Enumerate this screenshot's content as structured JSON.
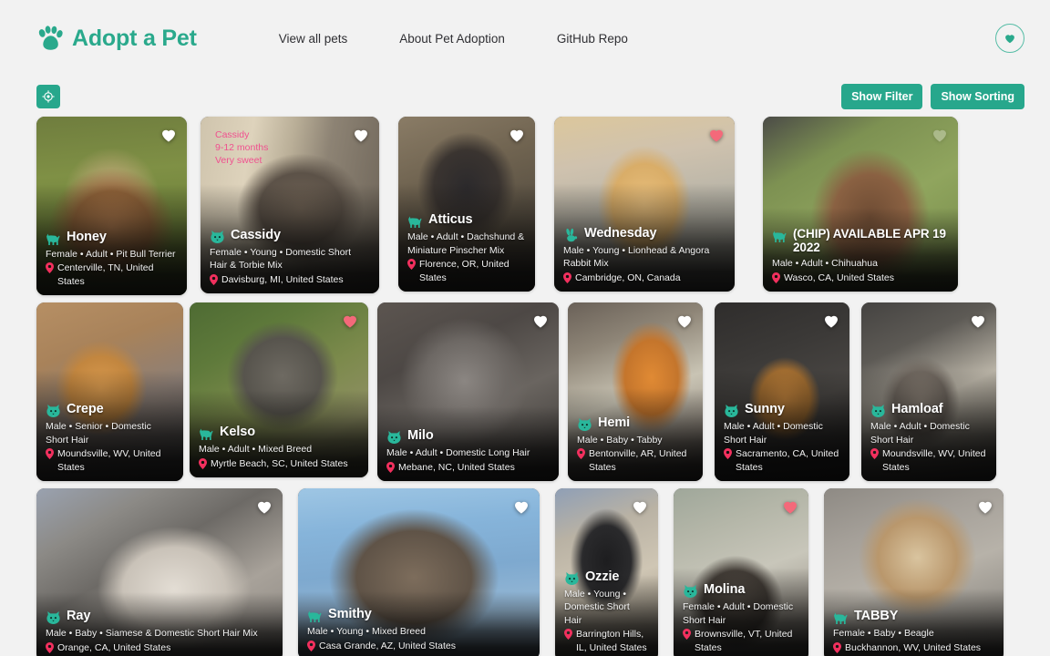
{
  "header": {
    "brand": "Adopt a Pet",
    "brand_color": "#2aa98c",
    "nav": [
      {
        "label": "View all pets"
      },
      {
        "label": "About Pet Adoption"
      },
      {
        "label": "GitHub Repo"
      }
    ],
    "favorites_icon": "heart-icon"
  },
  "toolbar": {
    "geolocate_icon": "target-crosshair-icon",
    "show_filter_label": "Show Filter",
    "show_sorting_label": "Show Sorting",
    "button_color": "#27a78c"
  },
  "colors": {
    "accent": "#27a78c",
    "heart_active": "#f4697a",
    "heart_inactive": "#ffffff",
    "pin": "#f2305e",
    "page_background": "#f2f2f2"
  },
  "pets": [
    {
      "name": "Honey",
      "meta": "Female • Adult • Pit Bull Terrier",
      "location": "Centerville, TN, United States",
      "species": "dog",
      "favorited": false,
      "photo_alt": "tan and white pit bull terrier standing in green grass"
    },
    {
      "name": "Cassidy",
      "meta": "Female • Young • Domestic Short Hair & Torbie Mix",
      "location": "Davisburg, MI, United States",
      "species": "cat",
      "favorited": false,
      "photo_caption": "Cassidy\n9-12 months\nVery sweet",
      "photo_alt": "grey tabby cat indoors"
    },
    {
      "name": "Atticus",
      "meta": "Male • Adult • Dachshund & Miniature Pinscher Mix",
      "location": "Florence, OR, United States",
      "species": "dog",
      "favorited": false,
      "photo_alt": "black and tan dachshund pinscher mix with purple leash"
    },
    {
      "name": "Wednesday",
      "meta": "Male • Young • Lionhead & Angora Rabbit Mix",
      "location": "Cambridge, ON, Canada",
      "species": "rabbit",
      "favorited": true,
      "photo_alt": "fluffy cream lionhead rabbit on a woven blanket"
    },
    {
      "name": "(CHIP) AVAILABLE APR 19 2022",
      "meta": "Male • Adult • Chihuahua",
      "location": "Wasco, CA, United States",
      "species": "dog",
      "favorited": false,
      "photo_alt": "brown chihuahua on green lawn"
    },
    {
      "name": "Crepe",
      "meta": "Male • Senior • Domestic Short Hair",
      "location": "Moundsville, WV, United States",
      "species": "cat",
      "favorited": false,
      "photo_alt": "orange tabby cat sitting in a cardboard box"
    },
    {
      "name": "Kelso",
      "meta": "Male • Adult • Mixed Breed",
      "location": "Myrtle Beach, SC, United States",
      "species": "dog",
      "favorited": true,
      "photo_alt": "brindle dog with tongue out in tall grass"
    },
    {
      "name": "Milo",
      "meta": "Male • Adult • Domestic Long Hair",
      "location": "Mebane, NC, United States",
      "species": "cat",
      "favorited": false,
      "photo_alt": "long haired grey and white cat close up"
    },
    {
      "name": "Hemi",
      "meta": "Male • Baby • Tabby",
      "location": "Bentonville, AR, United States",
      "species": "cat",
      "favorited": false,
      "photo_alt": "orange tabby kitten on a cat tree"
    },
    {
      "name": "Sunny",
      "meta": "Male • Adult • Domestic Short Hair",
      "location": "Sacramento, CA, United States",
      "species": "cat",
      "favorited": false,
      "photo_alt": "orange cat resting in a dark kennel"
    },
    {
      "name": "Hamloaf",
      "meta": "Male • Adult • Domestic Short Hair",
      "location": "Moundsville, WV, United States",
      "species": "cat",
      "favorited": false,
      "photo_alt": "tabby and white cat lying on patterned bedding"
    },
    {
      "name": "Ray",
      "meta": "Male • Baby • Siamese & Domestic Short Hair Mix",
      "location": "Orange, CA, United States",
      "species": "cat",
      "favorited": false,
      "photo_alt": "cream siamese mix kitten with blue eyes"
    },
    {
      "name": "Smithy",
      "meta": "Male • Young • Mixed Breed",
      "location": "Casa Grande, AZ, United States",
      "species": "dog",
      "favorited": false,
      "photo_alt": "brindle mixed breed dog against blue sky"
    },
    {
      "name": "Ozzie",
      "meta": "Male • Young • Domestic Short Hair",
      "location": "Barrington Hills, IL, United States",
      "species": "cat",
      "favorited": false,
      "photo_alt": "black cat standing near a doorway"
    },
    {
      "name": "Molina",
      "meta": "Female • Adult • Domestic Short Hair",
      "location": "Brownsville, VT, United States",
      "species": "cat",
      "favorited": true,
      "photo_alt": "tabby cat peeking from behind a chair"
    },
    {
      "name": "TABBY",
      "meta": "Female • Baby • Beagle",
      "location": "Buckhannon, WV, United States",
      "species": "dog",
      "favorited": false,
      "photo_alt": "beagle puppy held in a person's arms"
    }
  ]
}
